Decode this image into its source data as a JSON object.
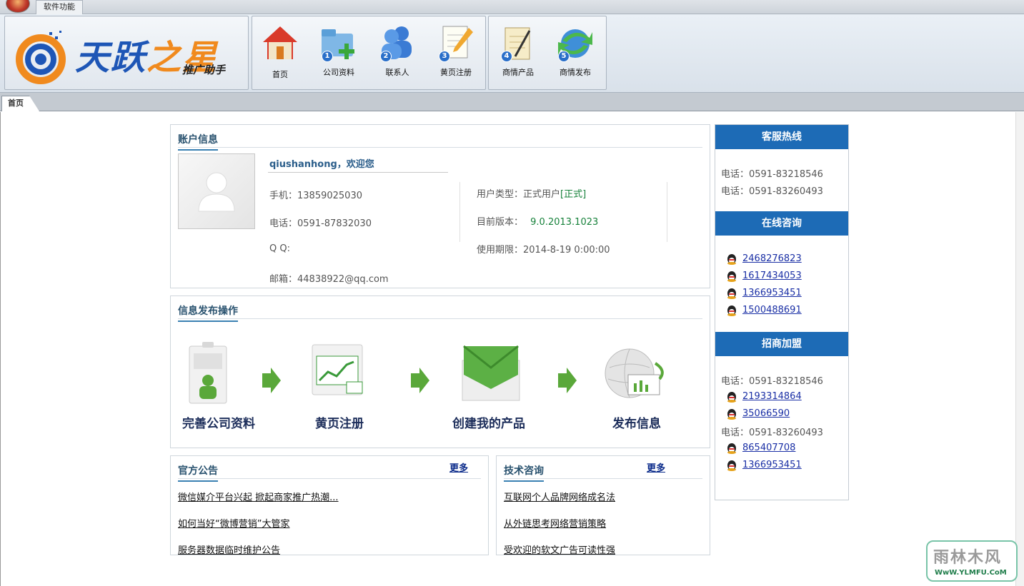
{
  "menu": {
    "tab_label": "软件功能"
  },
  "logo": {
    "brand_part1": "天跃",
    "brand_part2": "之星",
    "tagline": "推广助手"
  },
  "toolbar": [
    {
      "label": "首页",
      "icon": "home-icon"
    },
    {
      "label": "公司资料",
      "icon": "folder-add-icon",
      "num": "1"
    },
    {
      "label": "联系人",
      "icon": "contacts-icon",
      "num": "2"
    },
    {
      "label": "黄页注册",
      "icon": "edit-page-icon",
      "num": "3"
    },
    {
      "label": "商情产品",
      "icon": "notepad-icon",
      "num": "4"
    },
    {
      "label": "商情发布",
      "icon": "publish-icon",
      "num": "5"
    }
  ],
  "doc_tab": "首页",
  "account": {
    "title": "账户信息",
    "welcome": "qiushanhong，欢迎您",
    "mobile_label": "手机：",
    "mobile": "13859025030",
    "phone_label": "电话：",
    "phone": "0591-87832030",
    "qq_label": "Q Q:",
    "qq": "",
    "email_label": "邮箱：",
    "email": "44838922@qq.com",
    "user_type_label": "用户类型：",
    "user_type": "正式用户",
    "user_type_tag": "[正式]",
    "version_label": "目前版本：",
    "version": "9.0.2013.1023",
    "expiry_label": "使用期限：",
    "expiry": "2014-8-19 0:00:00"
  },
  "publish": {
    "title": "信息发布操作",
    "steps": [
      "完善公司资料",
      "黄页注册",
      "创建我的产品",
      "发布信息"
    ]
  },
  "announcements": {
    "title": "官方公告",
    "more": "更多",
    "items": [
      "微信媒介平台兴起 掀起商家推广热潮...",
      "如何当好“微博营销”大管家",
      "服务器数据临时维护公告"
    ]
  },
  "tech": {
    "title": "技术咨询",
    "more": "更多",
    "items": [
      "互联网个人品牌网络成名法",
      "从外链思考网络营销策略",
      "受欢迎的软文广告可读性强"
    ]
  },
  "sidebar": {
    "hotline_title": "客服热线",
    "hotline_lines": [
      "电话：0591-83218546",
      "电话：0591-83260493"
    ],
    "online_title": "在线咨询",
    "online_qq": [
      "2468276823",
      "1617434053",
      "1366953451",
      "1500488691"
    ],
    "join_title": "招商加盟",
    "join_phone1": "电话：0591-83218546",
    "join_qq1": [
      "2193314864",
      "35066590"
    ],
    "join_phone2": "电话：0591-83260493",
    "join_qq2": [
      "865407708",
      "1366953451"
    ]
  },
  "watermark": {
    "text": "雨林木风",
    "url": "WwW.YLMFU.CoM"
  },
  "colors": {
    "accent_blue": "#1d6bb6",
    "title_blue": "#28516e",
    "green": "#16813a",
    "brand_orange": "#f08a1e"
  }
}
